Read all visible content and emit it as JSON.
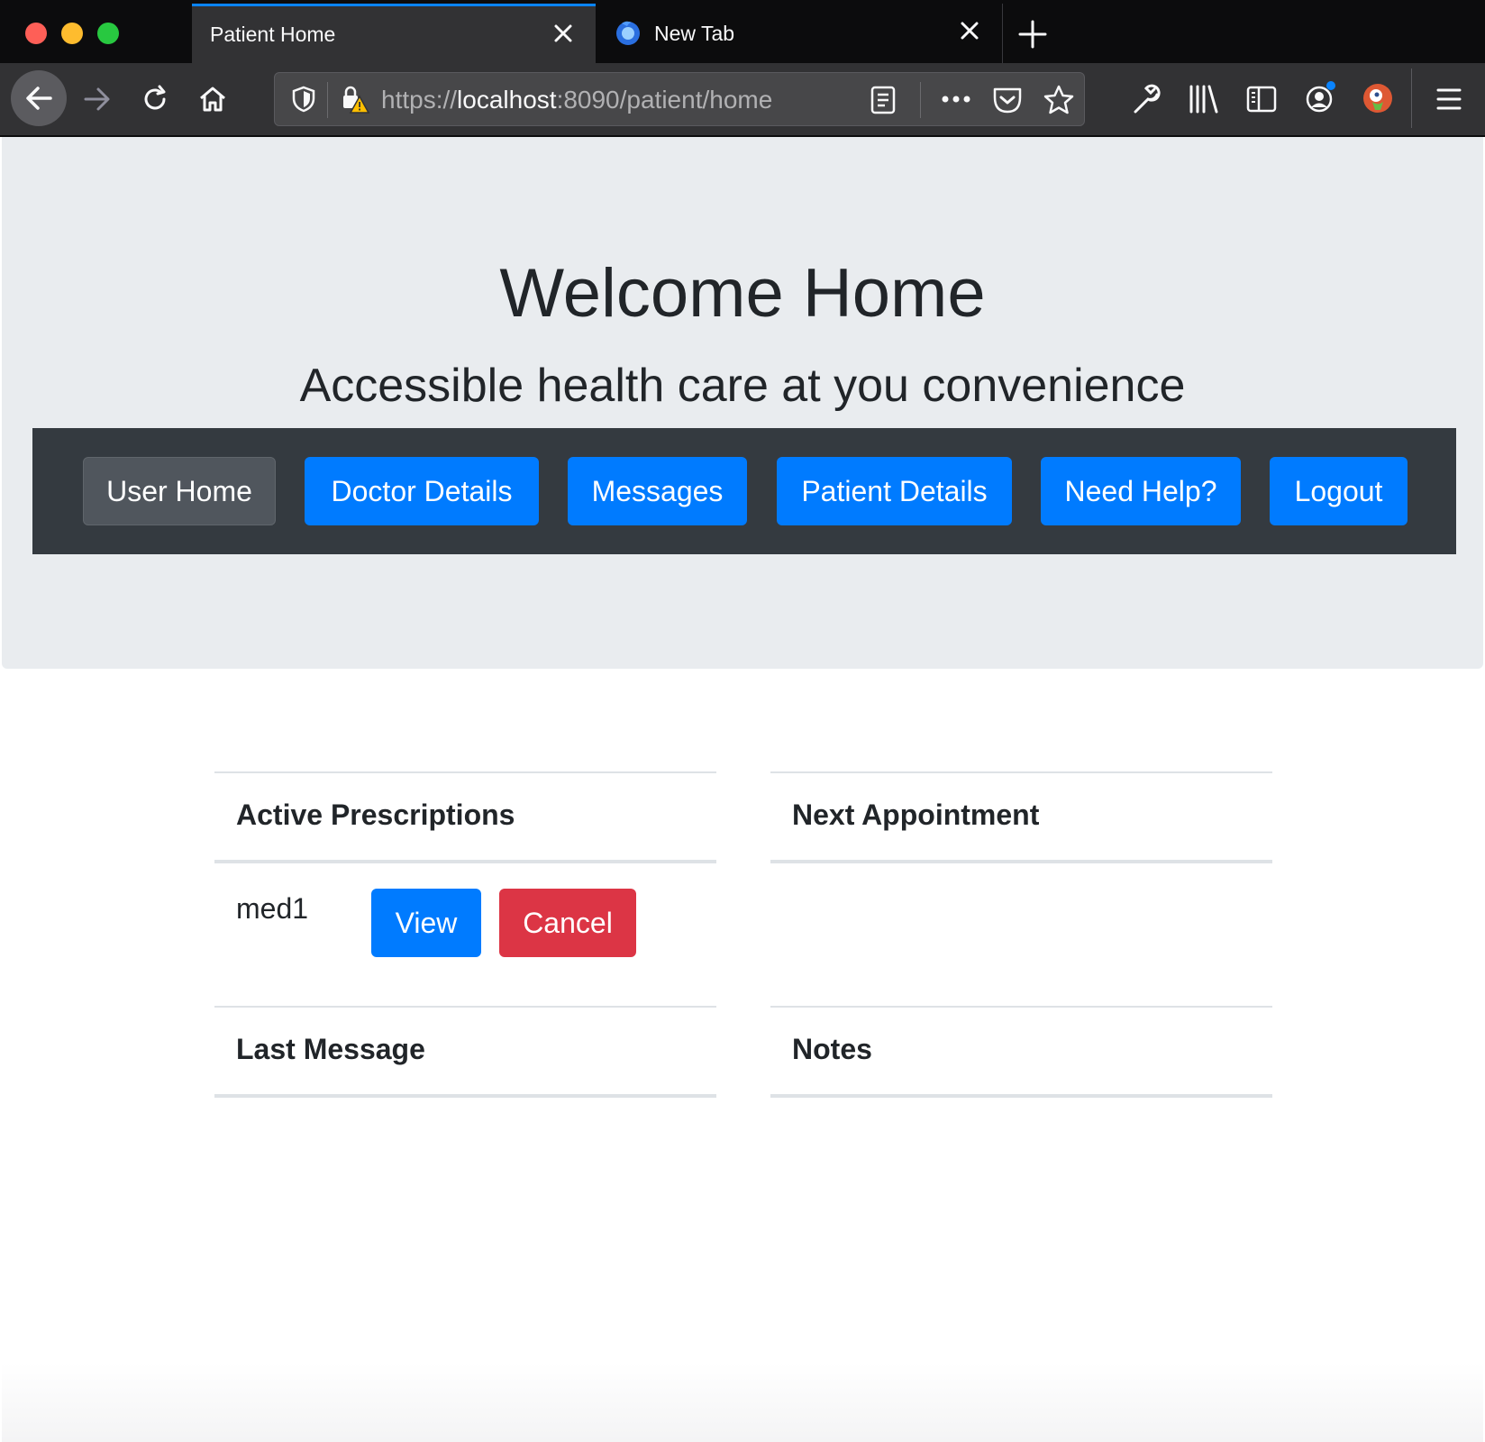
{
  "browser": {
    "tabs": [
      {
        "title": "Patient Home",
        "active": true
      },
      {
        "title": "New Tab",
        "active": false
      }
    ],
    "url": {
      "scheme": "https://",
      "host": "localhost",
      "rest": ":8090/patient/home"
    }
  },
  "header": {
    "title": "Welcome Home",
    "subtitle": "Accessible health care at you convenience"
  },
  "nav": {
    "items": [
      {
        "label": "User Home"
      },
      {
        "label": "Doctor Details"
      },
      {
        "label": "Messages"
      },
      {
        "label": "Patient Details"
      },
      {
        "label": "Need Help?"
      },
      {
        "label": "Logout"
      }
    ]
  },
  "cards": {
    "prescriptions": {
      "title": "Active Prescriptions",
      "items": [
        {
          "name": "med1",
          "view_label": "View",
          "cancel_label": "Cancel"
        }
      ]
    },
    "appointment": {
      "title": "Next Appointment"
    },
    "last_message": {
      "title": "Last Message"
    },
    "notes": {
      "title": "Notes"
    }
  },
  "colors": {
    "primary": "#007bff",
    "danger": "#dc3545",
    "secondary": "#50565d",
    "navbar": "#343a40",
    "jumbotron": "#e9ecef"
  }
}
